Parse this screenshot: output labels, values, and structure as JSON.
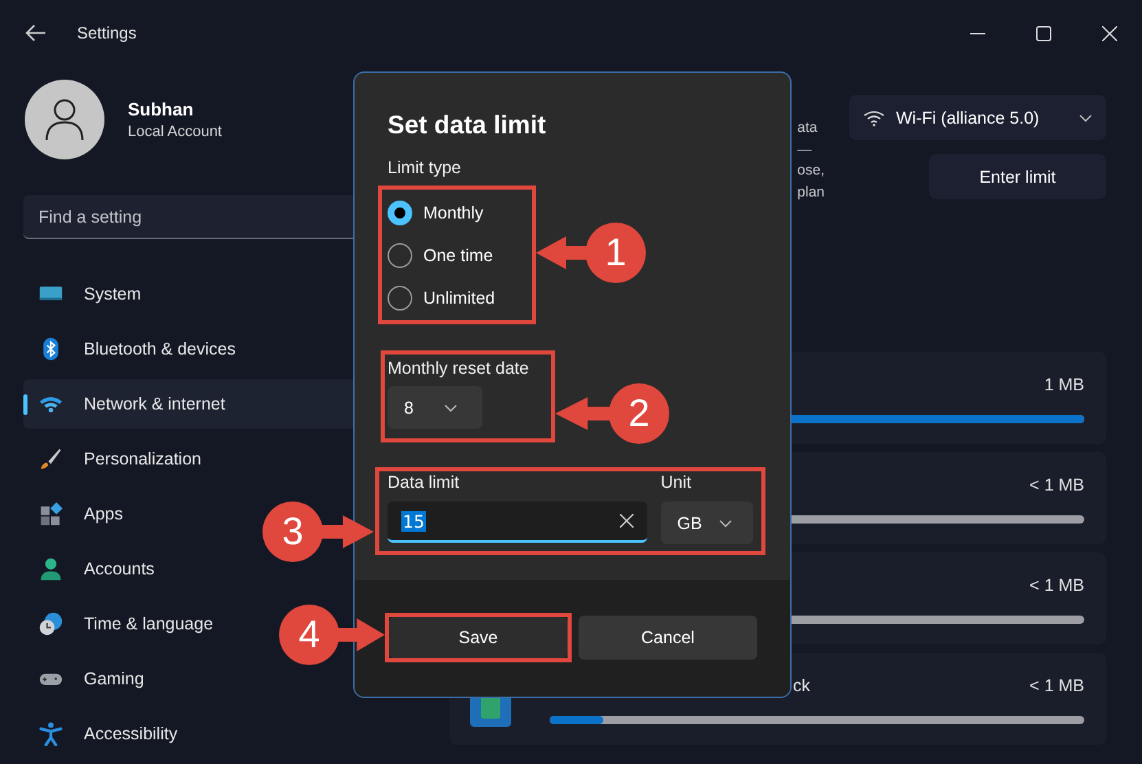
{
  "window": {
    "title": "Settings"
  },
  "profile": {
    "name": "Subhan",
    "account": "Local Account"
  },
  "search": {
    "placeholder": "Find a setting"
  },
  "nav": [
    {
      "label": "System",
      "kind": "system",
      "selected": false
    },
    {
      "label": "Bluetooth & devices",
      "kind": "bluetooth",
      "selected": false
    },
    {
      "label": "Network & internet",
      "kind": "network",
      "selected": true
    },
    {
      "label": "Personalization",
      "kind": "brush",
      "selected": false
    },
    {
      "label": "Apps",
      "kind": "apps",
      "selected": false
    },
    {
      "label": "Accounts",
      "kind": "person",
      "selected": false
    },
    {
      "label": "Time & language",
      "kind": "clock",
      "selected": false
    },
    {
      "label": "Gaming",
      "kind": "gamepad",
      "selected": false
    },
    {
      "label": "Accessibility",
      "kind": "accessibility",
      "selected": false
    }
  ],
  "content": {
    "description_lines": [
      "ata",
      "—",
      "ose,",
      "plan"
    ],
    "network_dropdown": "Wi-Fi (alliance 5.0)",
    "enter_limit_button": "Enter limit",
    "usage": [
      {
        "amount": "1 MB",
        "level": 1
      },
      {
        "amount": "< 1 MB"
      },
      {
        "amount": "< 1 MB"
      },
      {
        "label": "ck",
        "amount": "< 1 MB",
        "level": 0.1
      }
    ]
  },
  "dialog": {
    "title": "Set data limit",
    "limit_type_label": "Limit type",
    "limit_types": [
      {
        "label": "Monthly",
        "selected": true
      },
      {
        "label": "One time",
        "selected": false
      },
      {
        "label": "Unlimited",
        "selected": false
      }
    ],
    "reset_date_label": "Monthly reset date",
    "reset_date": "8",
    "data_limit_label": "Data limit",
    "data_limit": "15",
    "unit_label": "Unit",
    "unit": "GB",
    "buttons": [
      "Save",
      "Cancel"
    ]
  },
  "annotations": [
    "1",
    "2",
    "3",
    "4"
  ]
}
